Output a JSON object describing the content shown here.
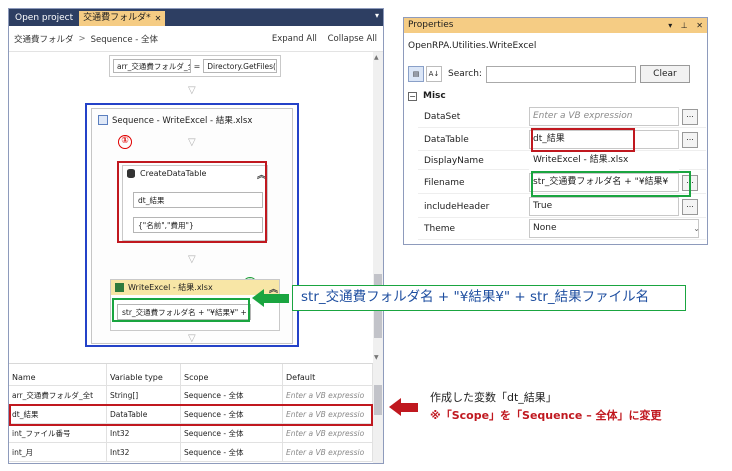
{
  "designer": {
    "tabs": [
      {
        "label": "Open project"
      },
      {
        "label": "交通費フォルダ*"
      }
    ],
    "close_glyph": "✕",
    "breadcrumb": [
      "交通費フォルダ",
      "Sequence - 全体"
    ],
    "breadcrumb_sep": ">",
    "expand_all": "Expand All",
    "collapse_all": "Collapse All",
    "assign": {
      "to": "arr_交通費フォルダ_全",
      "eq": "=",
      "value": "Directory.GetFiles(s"
    },
    "sequence": {
      "title": "Sequence - WriteExcel - 結果.xlsx",
      "create_datatable": {
        "marker": "①",
        "title": "CreateDataTable",
        "field1": "dt_結果",
        "field2": "{\"名前\",\"費用\"}"
      },
      "write_excel": {
        "marker": "②",
        "title": "WriteExcel - 結果.xlsx",
        "filename": "str_交通費フォルダ名 + \"¥結果¥\" +"
      }
    },
    "variables": {
      "headers": [
        "Name",
        "Variable type",
        "Scope",
        "Default"
      ],
      "rows": [
        {
          "name": "arr_交通費フォルダ_全t",
          "type": "String[]",
          "scope": "Sequence - 全体",
          "default": "Enter a VB expressio"
        },
        {
          "name": "dt_結果",
          "type": "DataTable",
          "scope": "Sequence - 全体",
          "default": "Enter a VB expressio"
        },
        {
          "name": "int_ファイル番号",
          "type": "Int32",
          "scope": "Sequence - 全体",
          "default": "Enter a VB expressio"
        },
        {
          "name": "int_月",
          "type": "Int32",
          "scope": "Sequence - 全体",
          "default": "Enter a VB expressio"
        }
      ]
    }
  },
  "properties": {
    "title": "Properties",
    "type_name": "OpenRPA.Utilities.WriteExcel",
    "search_label": "Search:",
    "clear_label": "Clear",
    "category": "Misc",
    "rows": [
      {
        "name": "DataSet",
        "value": "Enter a VB expression",
        "placeholder": true
      },
      {
        "name": "DataTable",
        "value": "dt_結果"
      },
      {
        "name": "DisplayName",
        "value": "WriteExcel - 結果.xlsx"
      },
      {
        "name": "Filename",
        "value": "str_交通費フォルダ名 + \"¥結果¥"
      },
      {
        "name": "includeHeader",
        "value": "True"
      },
      {
        "name": "Theme",
        "value": "None"
      }
    ],
    "ellipsis": "..."
  },
  "annotations": {
    "filename_expression": "str_交通費フォルダ名 + \"¥結果¥\" + str_結果ファイル名",
    "variable_note": "作成した変数「dt_結果」",
    "scope_note": "※「Scope」を「Sequence – 全体」に変更"
  },
  "colors": {
    "red_highlight": "#c0181f",
    "green_highlight": "#1aa540",
    "blue_highlight": "#2442c8",
    "tab_bar": "#2d3e62",
    "active_tab": "#f5cc84"
  }
}
